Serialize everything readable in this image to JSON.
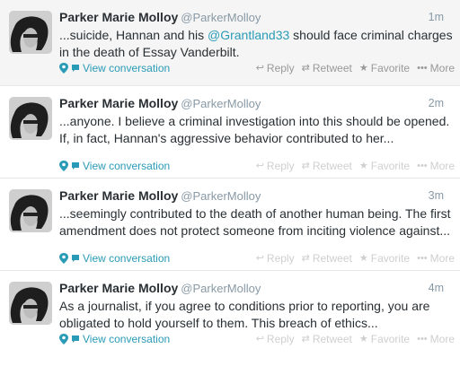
{
  "tweets": [
    {
      "name": "Parker Marie Molloy",
      "handle": "@ParkerMolloy",
      "time": "1m",
      "text_before": "...suicide, Hannan and his ",
      "mention": "@Grantland33",
      "text_after": " should face criminal charges in the death of Essay Vanderbilt.",
      "conversation": "View conversation",
      "actions": {
        "reply": "Reply",
        "retweet": "Retweet",
        "favorite": "Favorite",
        "more": "More"
      }
    },
    {
      "name": "Parker Marie Molloy",
      "handle": "@ParkerMolloy",
      "time": "2m",
      "text": "...anyone. I believe a criminal investigation into this should be opened. If, in fact, Hannan's aggressive behavior contributed to her...",
      "conversation": "View conversation",
      "actions": {
        "reply": "Reply",
        "retweet": "Retweet",
        "favorite": "Favorite",
        "more": "More"
      }
    },
    {
      "name": "Parker Marie Molloy",
      "handle": "@ParkerMolloy",
      "time": "3m",
      "text": "...seemingly contributed to the death of another human being. The first amendment does not protect someone from inciting violence against...",
      "conversation": "View conversation",
      "actions": {
        "reply": "Reply",
        "retweet": "Retweet",
        "favorite": "Favorite",
        "more": "More"
      }
    },
    {
      "name": "Parker Marie Molloy",
      "handle": "@ParkerMolloy",
      "time": "4m",
      "text": "As a journalist, if you agree to conditions prior to reporting, you are obligated to hold yourself to them. This breach of ethics...",
      "conversation": "View conversation",
      "actions": {
        "reply": "Reply",
        "retweet": "Retweet",
        "favorite": "Favorite",
        "more": "More"
      }
    }
  ],
  "icons": {
    "reply": "reply-icon",
    "retweet": "retweet-icon",
    "favorite": "star-icon",
    "more": "more-dots-icon",
    "location": "location-pin-icon",
    "conversation": "speech-bubble-icon"
  },
  "colors": {
    "link": "#2a9bb6",
    "name": "#292f33",
    "muted": "#8899a6",
    "highlight_bg": "#f5f5f5"
  }
}
